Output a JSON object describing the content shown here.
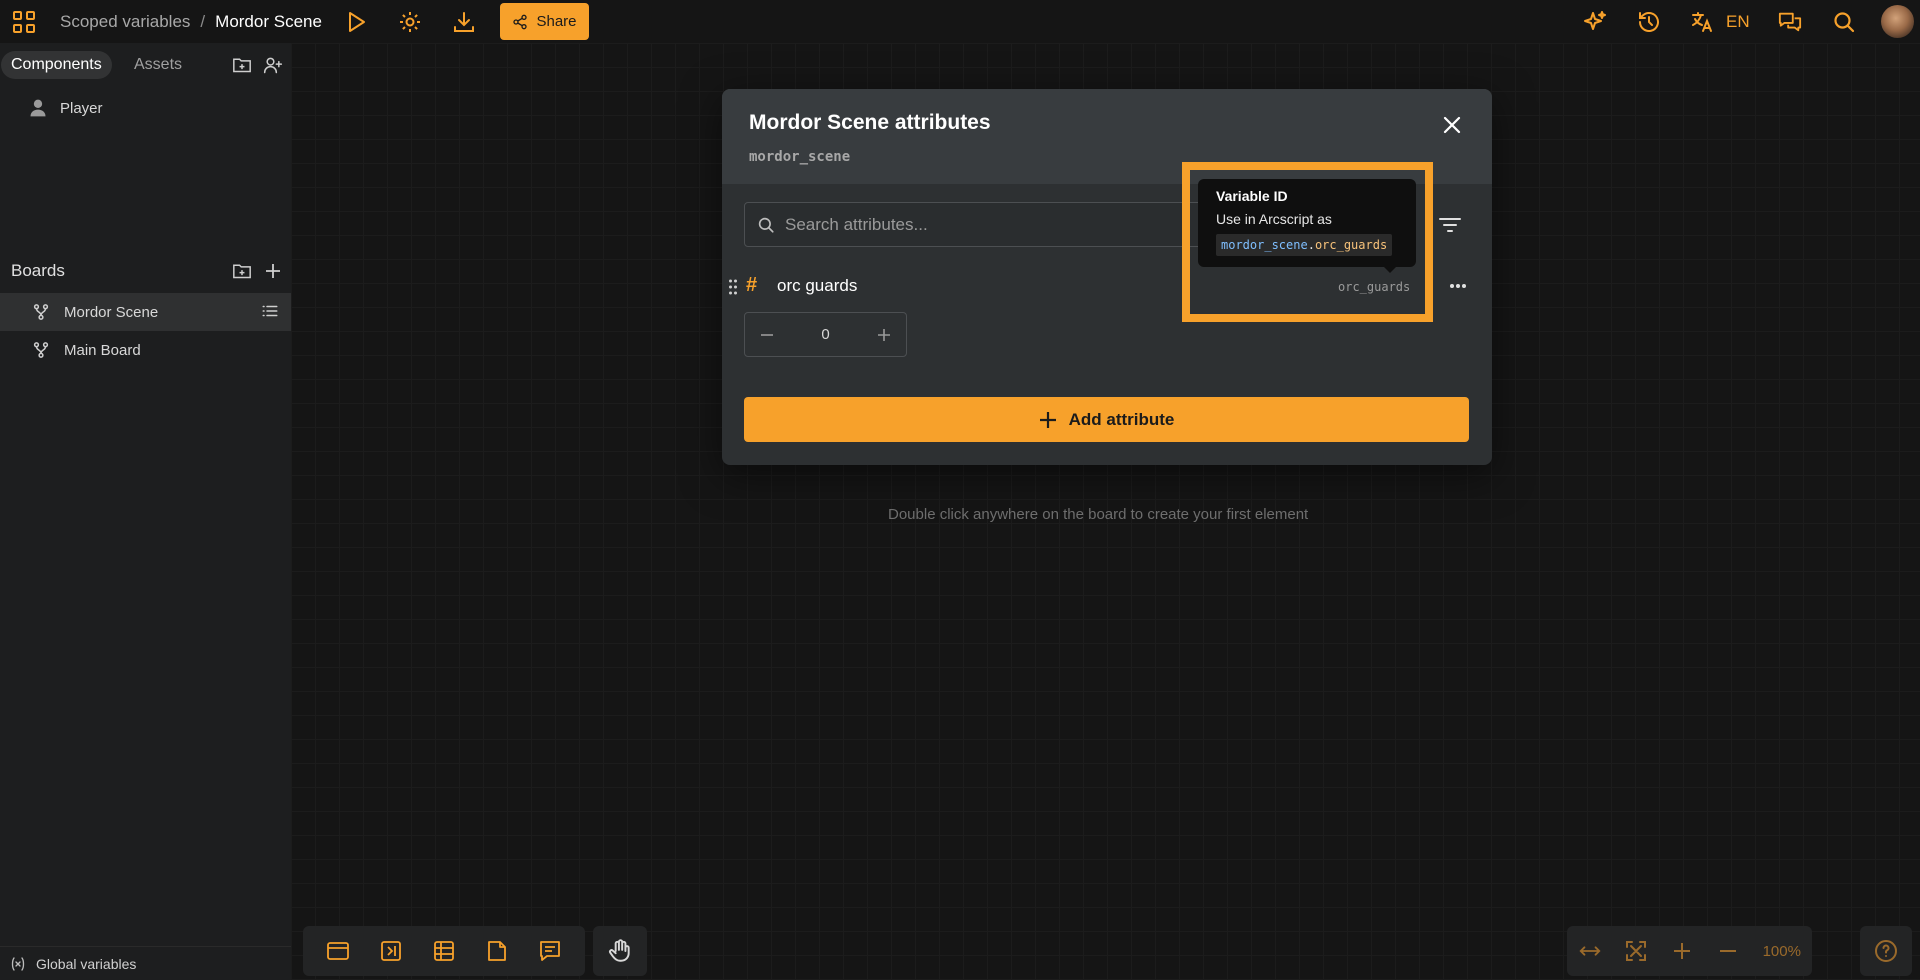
{
  "topbar": {
    "breadcrumb_project": "Scoped variables",
    "breadcrumb_separator": "/",
    "breadcrumb_board": "Mordor Scene",
    "share_label": "Share",
    "language": "EN"
  },
  "sidebar": {
    "tabs": [
      {
        "label": "Components"
      },
      {
        "label": "Assets"
      }
    ],
    "components": [
      {
        "label": "Player"
      }
    ],
    "boards_heading": "Boards",
    "boards": [
      {
        "label": "Mordor Scene"
      },
      {
        "label": "Main Board"
      }
    ],
    "global_variables_label": "Global variables"
  },
  "canvas": {
    "hint": "Double click anywhere on the board to create your first element",
    "zoom": "100%"
  },
  "dialog": {
    "title": "Mordor Scene attributes",
    "scope_id": "mordor_scene",
    "search_placeholder": "Search attributes...",
    "attributes": [
      {
        "type_icon": "#",
        "name": "orc guards",
        "id": "orc_guards",
        "value": "0"
      }
    ],
    "add_label": "Add attribute"
  },
  "tooltip": {
    "title": "Variable ID",
    "description": "Use in Arcscript as",
    "code_scope": "mordor_scene",
    "code_dot": ".",
    "code_var": "orc_guards"
  },
  "colors": {
    "accent": "#f7a12b",
    "background": "#151515",
    "sidebar": "#1d1e1f",
    "dialog": "#2d3032",
    "tooltip": "#0f0f0f"
  }
}
